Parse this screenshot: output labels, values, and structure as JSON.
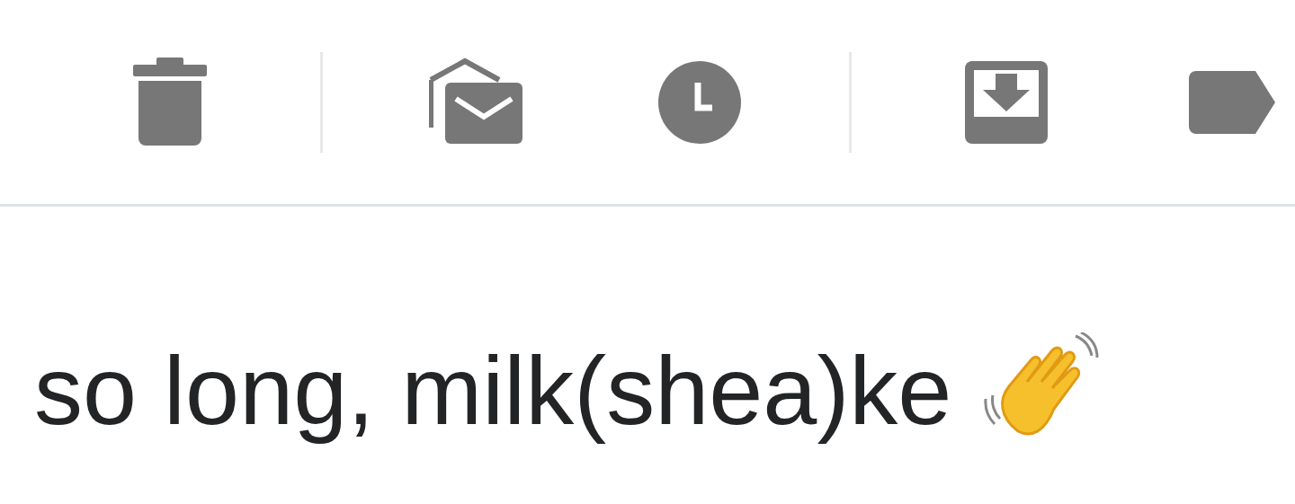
{
  "heading": "so long, milk(shea)ke"
}
